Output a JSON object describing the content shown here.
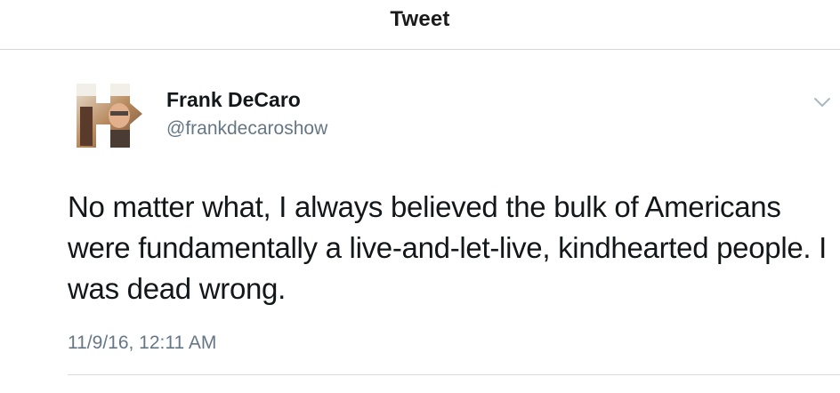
{
  "nav": {
    "title": "Tweet"
  },
  "tweet": {
    "display_name": "Frank DeCaro",
    "handle": "@frankdecaroshow",
    "text": "No matter what, I always believed the bulk of Americans were fundamentally a live-and-let-live, kindhearted people. I was dead wrong.",
    "timestamp": "11/9/16, 12:11 AM",
    "avatar_icon": "profile-photo-h-logo-icon",
    "menu_icon": "chevron-down-icon"
  },
  "colors": {
    "text_primary": "#14171a",
    "text_secondary": "#657786",
    "divider": "#dcdcdc"
  }
}
